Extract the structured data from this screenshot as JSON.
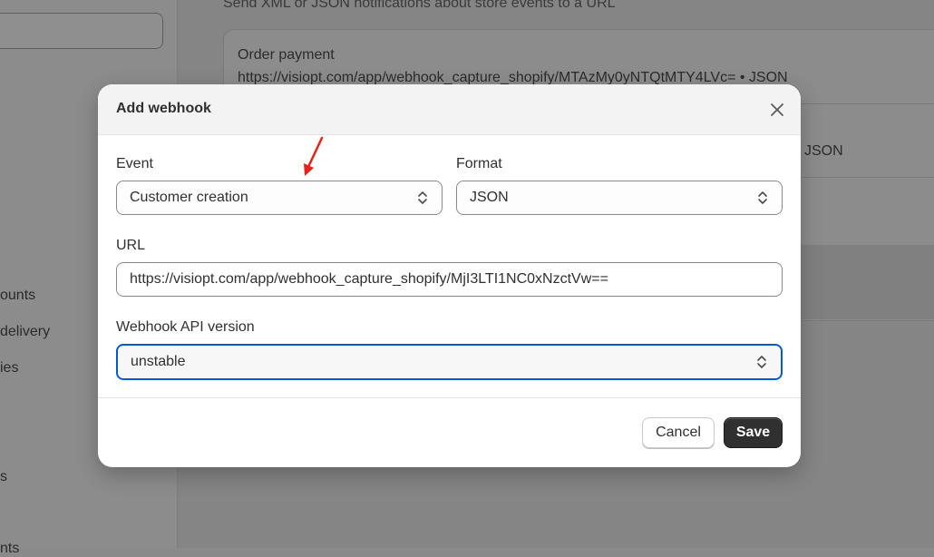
{
  "background": {
    "description": "Send XML or JSON notifications about store events to a URL",
    "webhooks": [
      {
        "event": "Order payment",
        "url": "https://visiopt.com/app/webhook_capture_shopify/MTAzMy0yNTQtMTY4LVc= • JSON"
      },
      {
        "event": "",
        "url": "JSON"
      }
    ],
    "sidebar_items": [
      "ounts",
      "delivery",
      "ies",
      "s",
      "nts"
    ]
  },
  "modal": {
    "title": "Add webhook",
    "event_label": "Event",
    "event_value": "Customer creation",
    "format_label": "Format",
    "format_value": "JSON",
    "url_label": "URL",
    "url_value": "https://visiopt.com/app/webhook_capture_shopify/MjI3LTI1NC0xNzctVw==",
    "api_label": "Webhook API version",
    "api_value": "unstable",
    "cancel_label": "Cancel",
    "save_label": "Save"
  },
  "icons": {
    "close": "close-icon",
    "select_chevron": "chevron-up-down-icon",
    "annotation": "red-arrow-annotation"
  },
  "colors": {
    "focus_border": "#005bd3",
    "primary_button": "#303030",
    "arrow": "#e8221b"
  }
}
